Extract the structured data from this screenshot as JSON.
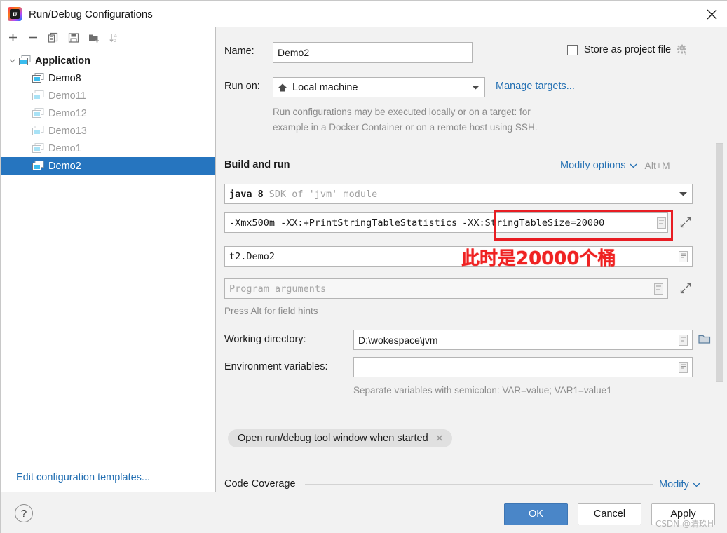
{
  "window": {
    "title": "Run/Debug Configurations",
    "app_icon": "intellij-idea-logo",
    "close_icon": "close-icon"
  },
  "sidebar": {
    "toolbar": [
      {
        "name": "add-configuration",
        "icon": "plus-icon"
      },
      {
        "name": "remove-configuration",
        "icon": "minus-icon"
      },
      {
        "name": "copy-configuration",
        "icon": "copy-icon"
      },
      {
        "name": "save-configuration",
        "icon": "save-icon"
      },
      {
        "name": "move-into-folder",
        "icon": "folder-add-icon"
      },
      {
        "name": "sort-configurations",
        "icon": "sort-alpha-icon"
      }
    ],
    "tree": [
      {
        "label": "Application",
        "type": "group",
        "expanded": true,
        "dim": false,
        "selected": false
      },
      {
        "label": "Demo8",
        "type": "child",
        "dim": false,
        "selected": false
      },
      {
        "label": "Demo11",
        "type": "child",
        "dim": true,
        "selected": false
      },
      {
        "label": "Demo12",
        "type": "child",
        "dim": true,
        "selected": false
      },
      {
        "label": "Demo13",
        "type": "child",
        "dim": true,
        "selected": false
      },
      {
        "label": "Demo1",
        "type": "child",
        "dim": true,
        "selected": false
      },
      {
        "label": "Demo2",
        "type": "child",
        "dim": false,
        "selected": true
      }
    ],
    "edit_templates_link": "Edit configuration templates..."
  },
  "form": {
    "name_label": "Name:",
    "name_value": "Demo2",
    "store_as_project_file_label": "Store as project file",
    "store_as_project_file_checked": false,
    "store_gear_icon": "gear-icon",
    "run_on_label": "Run on:",
    "run_on_value": "Local machine",
    "run_on_icon": "home-icon",
    "manage_targets_link": "Manage targets...",
    "run_on_hint_line1": "Run configurations may be executed locally or on a target: for",
    "run_on_hint_line2": "example in a Docker Container or on a remote host using SSH.",
    "build_and_run_title": "Build and run",
    "modify_options_link": "Modify options",
    "modify_options_shortcut": "Alt+M",
    "jre_value_bold": "java 8",
    "jre_value_dim": "SDK of 'jvm' module",
    "vm_args_left": "-Xmx500m -XX:+PrintStringTableStatistics",
    "vm_args_highlighted": "-XX:StringTableSize=20000",
    "main_class_value": "t2.Demo2",
    "program_arguments_placeholder": "Program arguments",
    "field_hints_text": "Press Alt for field hints",
    "working_directory_label": "Working directory:",
    "working_directory_value": "D:\\wokespace\\jvm",
    "environment_variables_label": "Environment variables:",
    "environment_variables_value": "",
    "environment_hint": "Separate variables with semicolon: VAR=value; VAR1=value1",
    "tool_window_chip": "Open run/debug tool window when started",
    "code_coverage_title": "Code Coverage",
    "code_coverage_modify_link": "Modify"
  },
  "annotation": {
    "note_text": "此时是20000个桶",
    "box_color": "#e81d23",
    "text_color": "#ef2222"
  },
  "footer": {
    "help_label": "?",
    "ok_label": "OK",
    "cancel_label": "Cancel",
    "apply_label": "Apply"
  },
  "watermark": "CSDN @清玖H"
}
